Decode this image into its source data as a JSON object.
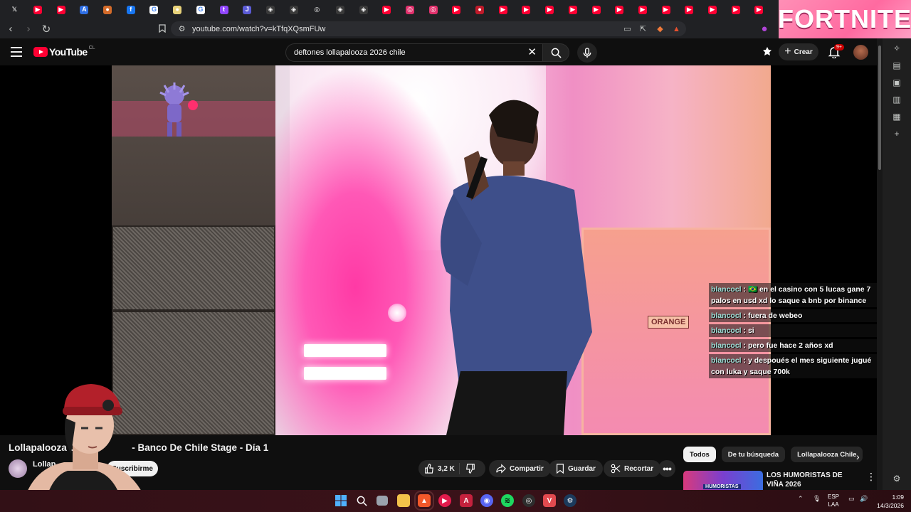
{
  "browser": {
    "tabs": [
      {
        "icon": "x-icon",
        "glyph": "𝕏",
        "color": "#202124"
      },
      {
        "icon": "youtube-icon",
        "glyph": "▶",
        "color": "#ff0033"
      },
      {
        "icon": "youtube-icon",
        "glyph": "▶",
        "color": "#ff0033"
      },
      {
        "icon": "atlassian-icon",
        "glyph": "A",
        "color": "#2f6fe4"
      },
      {
        "icon": "tab-icon",
        "glyph": "●",
        "color": "#d46b2a"
      },
      {
        "icon": "facebook-icon",
        "glyph": "f",
        "color": "#1877f2"
      },
      {
        "icon": "google-icon",
        "glyph": "G",
        "color": "#ffffff"
      },
      {
        "icon": "tab-icon",
        "glyph": "●",
        "color": "#e8d27a"
      },
      {
        "icon": "google-icon",
        "glyph": "G",
        "color": "#ffffff"
      },
      {
        "icon": "twitch-icon",
        "glyph": "t",
        "color": "#9146ff"
      },
      {
        "icon": "tab-icon",
        "glyph": "J",
        "color": "#5b5bd6"
      },
      {
        "icon": "chatgpt-icon",
        "glyph": "◈",
        "color": "#3a3a3a"
      },
      {
        "icon": "chatgpt-icon",
        "glyph": "◈",
        "color": "#3a3a3a"
      },
      {
        "icon": "tab-icon",
        "glyph": "◎",
        "color": "#202124"
      },
      {
        "icon": "chatgpt-icon",
        "glyph": "◈",
        "color": "#3a3a3a"
      },
      {
        "icon": "chatgpt-icon",
        "glyph": "◈",
        "color": "#3a3a3a"
      },
      {
        "icon": "youtube-icon",
        "glyph": "▶",
        "color": "#ff0033"
      },
      {
        "icon": "instagram-icon",
        "glyph": "◎",
        "color": "#e1306c"
      },
      {
        "icon": "instagram-icon",
        "glyph": "◎",
        "color": "#e1306c"
      },
      {
        "icon": "youtube-icon",
        "glyph": "▶",
        "color": "#ff0033"
      },
      {
        "icon": "tab-icon",
        "glyph": "●",
        "color": "#c01a2a"
      },
      {
        "icon": "youtube-icon",
        "glyph": "▶",
        "color": "#ff0033"
      },
      {
        "icon": "youtube-icon",
        "glyph": "▶",
        "color": "#ff0033"
      },
      {
        "icon": "youtube-icon",
        "glyph": "▶",
        "color": "#ff0033"
      },
      {
        "icon": "youtube-icon",
        "glyph": "▶",
        "color": "#ff0033"
      },
      {
        "icon": "youtube-icon",
        "glyph": "▶",
        "color": "#ff0033"
      },
      {
        "icon": "youtube-icon",
        "glyph": "▶",
        "color": "#ff0033"
      },
      {
        "icon": "youtube-icon",
        "glyph": "▶",
        "color": "#ff0033"
      },
      {
        "icon": "youtube-icon",
        "glyph": "▶",
        "color": "#ff0033"
      },
      {
        "icon": "youtube-icon",
        "glyph": "▶",
        "color": "#ff0033"
      },
      {
        "icon": "youtube-icon",
        "glyph": "▶",
        "color": "#ff0033"
      },
      {
        "icon": "youtube-icon",
        "glyph": "▶",
        "color": "#ff0033"
      },
      {
        "icon": "youtube-icon",
        "glyph": "▶",
        "color": "#ff0033"
      }
    ],
    "ad_text": "FORTNITE",
    "url": "youtube.com/watch?v=kTfqXQsmFUw"
  },
  "header": {
    "logo_text": "YouTube",
    "country_code": "CL",
    "search_query": "deftones lollapalooza 2026 chile",
    "create_label": "Crear",
    "notifications_badge": "9+"
  },
  "chat": [
    {
      "user": "blancocl",
      "sep": " : ",
      "text": "🇧🇷 en el casino con 5 lucas gane 7 palos en usd xd lo saque a bnb por binance"
    },
    {
      "user": "blancocl",
      "sep": " : ",
      "text": "fuera de webeo"
    },
    {
      "user": "blancocl",
      "sep": " : ",
      "text": "si"
    },
    {
      "user": "blancocl",
      "sep": " : ",
      "text": "pero fue hace 2 años xd"
    },
    {
      "user": "blancocl",
      "sep": " : ",
      "text": "y despoués el mes siguiente jugué con luka y saque 700k"
    }
  ],
  "video_overlay": {
    "amp_label": "ORANGE"
  },
  "video": {
    "title_left": "Lollapalooza C",
    "title_right": "- Banco De Chile Stage - Día 1",
    "channel_name": "Lollap",
    "subscribe_label": "Suscribirme",
    "likes": "3,2 K",
    "share_label": "Compartir",
    "save_label": "Guardar",
    "clip_label": "Recortar"
  },
  "sidebar": {
    "chips": [
      {
        "label": "Todos",
        "active": true
      },
      {
        "label": "De tu búsqueda",
        "active": false
      },
      {
        "label": "Lollapalooza Chile",
        "active": false
      }
    ],
    "recommendation": {
      "title": "LOS HUMORISTAS DE VIÑA 2026",
      "thumb_text": "HUMORISTAS"
    }
  },
  "taskbar": {
    "lang_top": "ESP",
    "lang_bottom": "LAA",
    "time": "1:09",
    "date": "14/3/2026"
  }
}
